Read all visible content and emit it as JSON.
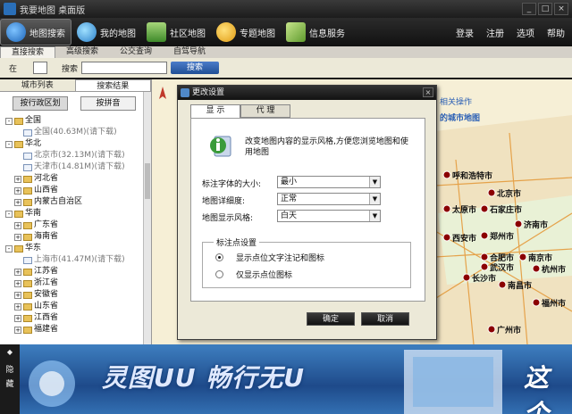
{
  "window": {
    "title": "我要地图 桌面版",
    "min": "_",
    "max": "□",
    "close": "×"
  },
  "toolbar": {
    "items": [
      {
        "label": "地图搜索",
        "icon": "globe-search-icon"
      },
      {
        "label": "我的地图",
        "icon": "users-icon"
      },
      {
        "label": "社区地图",
        "icon": "buildings-icon"
      },
      {
        "label": "专题地图",
        "icon": "e-topic-icon"
      },
      {
        "label": "信息服务",
        "icon": "pen-note-icon"
      }
    ],
    "right": [
      "登录",
      "注册",
      "选项",
      "帮助"
    ]
  },
  "subtabs": [
    "直接搜索",
    "高级搜索",
    "公交查询",
    "自驾导航"
  ],
  "search": {
    "in_label": "在",
    "keyword_label": "搜索",
    "value": "",
    "button": "搜索"
  },
  "leftpanel": {
    "tabs": [
      "城市列表",
      "搜索结果"
    ],
    "buttons": [
      "按行政区划",
      "按拼音"
    ],
    "tree": [
      {
        "level": 0,
        "toggle": "-",
        "folder": true,
        "label": "全国"
      },
      {
        "level": 1,
        "toggle": "",
        "folder": false,
        "label": "全国(40.63M)(请下载)",
        "download": true
      },
      {
        "level": 0,
        "toggle": "-",
        "folder": true,
        "label": "华北"
      },
      {
        "level": 1,
        "toggle": "",
        "folder": false,
        "label": "北京市(32.13M)(请下载)",
        "download": true
      },
      {
        "level": 1,
        "toggle": "",
        "folder": false,
        "label": "天津市(14.81M)(请下载)",
        "download": true
      },
      {
        "level": 1,
        "toggle": "+",
        "folder": true,
        "label": "河北省"
      },
      {
        "level": 1,
        "toggle": "+",
        "folder": true,
        "label": "山西省"
      },
      {
        "level": 1,
        "toggle": "+",
        "folder": true,
        "label": "内蒙古自治区"
      },
      {
        "level": 0,
        "toggle": "-",
        "folder": true,
        "label": "华南"
      },
      {
        "level": 1,
        "toggle": "+",
        "folder": true,
        "label": "广东省"
      },
      {
        "level": 1,
        "toggle": "+",
        "folder": true,
        "label": "海南省"
      },
      {
        "level": 0,
        "toggle": "-",
        "folder": true,
        "label": "华东"
      },
      {
        "level": 1,
        "toggle": "",
        "folder": false,
        "label": "上海市(41.47M)(请下载)",
        "download": true
      },
      {
        "level": 1,
        "toggle": "+",
        "folder": true,
        "label": "江苏省"
      },
      {
        "level": 1,
        "toggle": "+",
        "folder": true,
        "label": "浙江省"
      },
      {
        "level": 1,
        "toggle": "+",
        "folder": true,
        "label": "安徽省"
      },
      {
        "level": 1,
        "toggle": "+",
        "folder": true,
        "label": "山东省"
      },
      {
        "level": 1,
        "toggle": "+",
        "folder": true,
        "label": "江西省"
      },
      {
        "level": 1,
        "toggle": "+",
        "folder": true,
        "label": "福建省"
      }
    ]
  },
  "map": {
    "notes": [
      "相关操作",
      "的城市地图"
    ],
    "cities": [
      {
        "name": "呼和浩特市"
      },
      {
        "name": "北京市"
      },
      {
        "name": "石家庄市"
      },
      {
        "name": "太原市"
      },
      {
        "name": "济南市"
      },
      {
        "name": "郑州市"
      },
      {
        "name": "西安市"
      },
      {
        "name": "合肥市"
      },
      {
        "name": "南京市"
      },
      {
        "name": "武汉市"
      },
      {
        "name": "杭州市"
      },
      {
        "name": "长沙市"
      },
      {
        "name": "南昌市"
      },
      {
        "name": "福州市"
      },
      {
        "name": "广州市"
      }
    ]
  },
  "banner": {
    "slogan": "灵图UU 畅行无U",
    "side_label": "隐藏",
    "right_text": "这个"
  },
  "dialog": {
    "title": "更改设置",
    "tabs": [
      "显 示",
      "代 理"
    ],
    "description": "改变地图内容的显示风格,方便您浏览地图和使用地图",
    "fields": [
      {
        "label": "标注字体的大小:",
        "value": "最小"
      },
      {
        "label": "地图详细度:",
        "value": "正常"
      },
      {
        "label": "地图显示风格:",
        "value": "白天"
      }
    ],
    "group_title": "标注点设置",
    "radios": [
      {
        "label": "显示点位文字注记和图标",
        "checked": true
      },
      {
        "label": "仅显示点位图标",
        "checked": false
      }
    ],
    "ok": "确定",
    "cancel": "取消"
  },
  "colors": {
    "accent": "#1f4e96",
    "marker": "#8b0000",
    "map_bg": "#f6efd6"
  }
}
